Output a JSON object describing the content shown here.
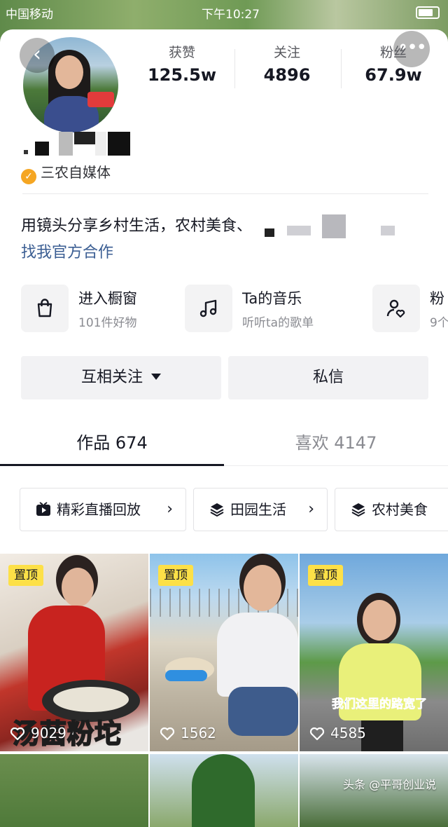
{
  "status_bar": {
    "carrier": "中国移动",
    "time": "下午10:27"
  },
  "profile": {
    "verified_label": "三农自媒体",
    "bio": "用镜头分享乡村生活，农村美食、",
    "bio_link": "找我官方合作"
  },
  "stats": [
    {
      "label": "获赞",
      "value": "125.5w"
    },
    {
      "label": "关注",
      "value": "4896"
    },
    {
      "label": "粉丝",
      "value": "67.9w"
    }
  ],
  "features": [
    {
      "title": "进入橱窗",
      "subtitle": "101件好物",
      "icon": "shopping-bag-icon"
    },
    {
      "title": "Ta的音乐",
      "subtitle": "听听ta的歌单",
      "icon": "music-note-icon"
    },
    {
      "title": "粉",
      "subtitle": "9个",
      "icon": "fan-group-icon"
    }
  ],
  "buttons": {
    "follow": "互相关注",
    "message": "私信"
  },
  "tabs": [
    {
      "label": "作品 674"
    },
    {
      "label": "喜欢 4147"
    }
  ],
  "chips": [
    {
      "label": "精彩直播回放",
      "icon": "live-replay-icon"
    },
    {
      "label": "田园生活",
      "icon": "layers-icon"
    },
    {
      "label": "农村美食",
      "icon": "layers-icon"
    }
  ],
  "videos": [
    {
      "pinned": "置顶",
      "likes": "9029",
      "caption": "汤菌粉坨"
    },
    {
      "pinned": "置顶",
      "likes": "1562"
    },
    {
      "pinned": "置顶",
      "likes": "4585",
      "caption": "我们这里的路宽了"
    }
  ],
  "watermark": "头条 @平哥创业说",
  "colors": {
    "pin_bg": "#fde047",
    "verify_badge": "#f5a623",
    "link": "#3b5e93"
  }
}
